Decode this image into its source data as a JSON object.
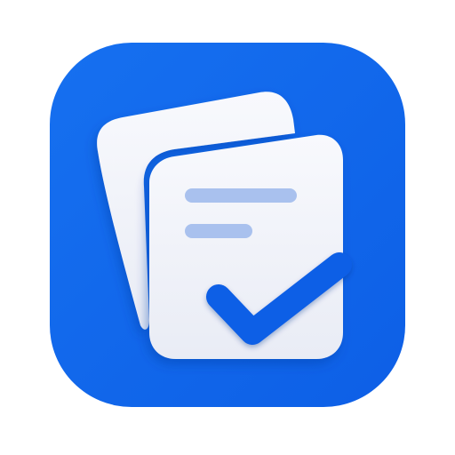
{
  "app_icon": {
    "icon_name": "task-checklist-app-icon",
    "colors": {
      "tile_background": "#0f66ea",
      "page_back": "#eef1f8",
      "page_front": "#f5f6fb",
      "text_lines": "#a9c1ee",
      "checkmark": "#0f5ee6"
    }
  }
}
